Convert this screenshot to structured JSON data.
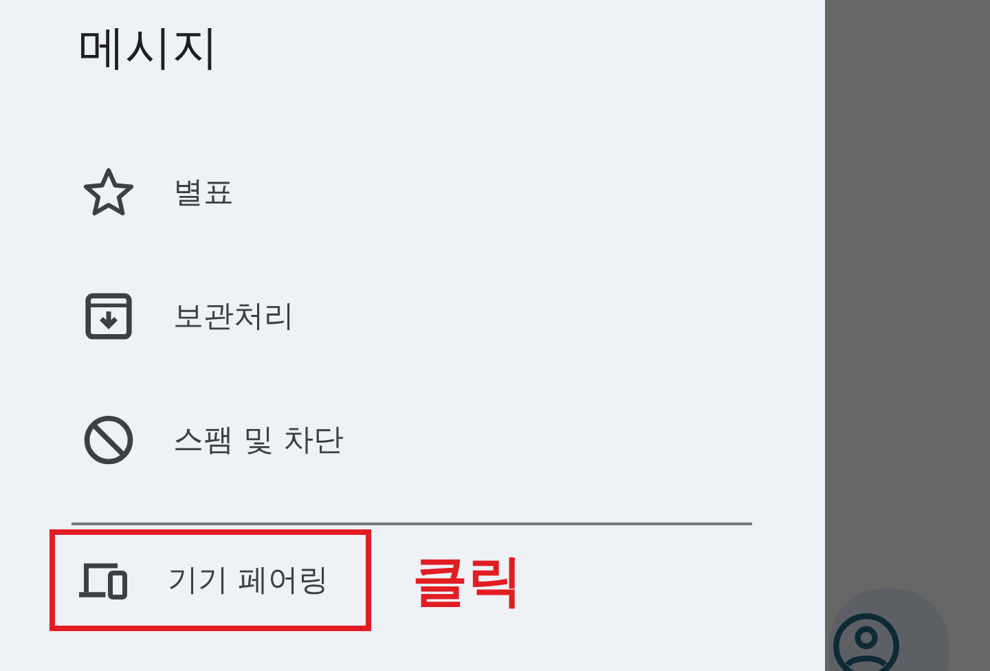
{
  "drawer": {
    "title": "메시지",
    "items": [
      {
        "kind": "star",
        "label": "별표",
        "highlighted": false
      },
      {
        "kind": "archive",
        "label": "보관처리",
        "highlighted": false
      },
      {
        "kind": "block",
        "label": "스팸 및 차단",
        "highlighted": false
      },
      {
        "kind": "devices",
        "label": "기기 페어링",
        "highlighted": true
      }
    ]
  },
  "annotation": {
    "text": "클릭"
  }
}
